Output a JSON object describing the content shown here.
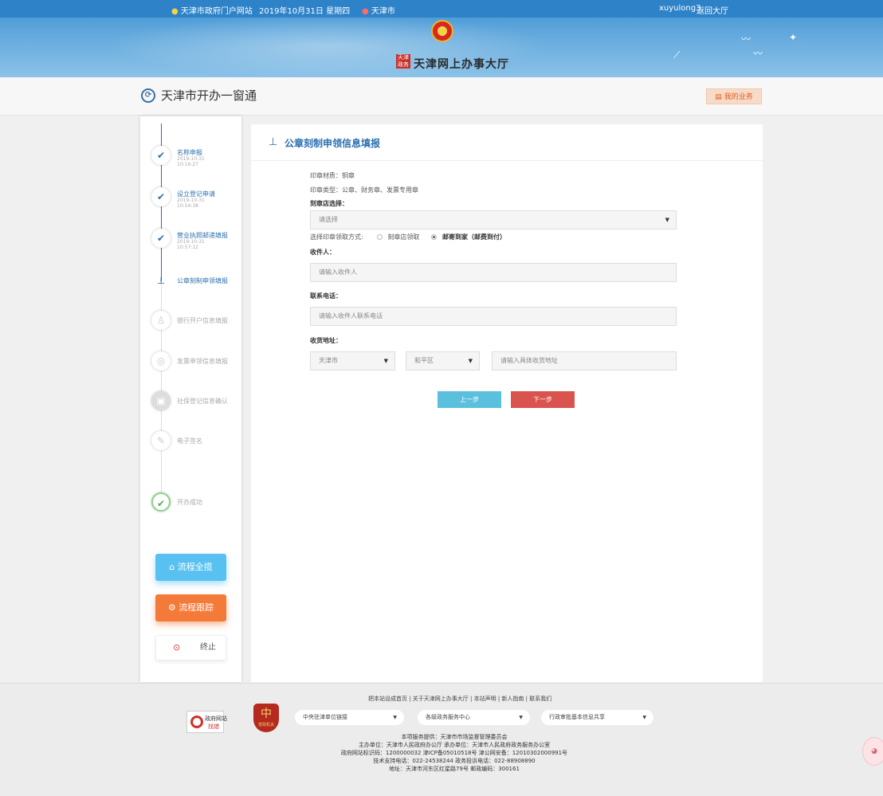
{
  "header": {
    "portal_link": "天津市政府门户网站",
    "date": "2019年10月31日 星期四",
    "city": "天津市",
    "username": "xuyulong3",
    "back_link": "返回大厅",
    "logo_badge": "天津政务",
    "hall_title": "天津网上办事大厅"
  },
  "subheader": {
    "title": "天津市开办一窗通",
    "my_business": "我的业务"
  },
  "steps": [
    {
      "label": "名称申报",
      "date": "2019-10-31\n10:16:27",
      "status": "done"
    },
    {
      "label": "设立登记申请",
      "date": "2019-10-31\n10:54:38",
      "status": "done"
    },
    {
      "label": "营业执照邮递填报",
      "date": "2019-10-31\n10:57:12",
      "status": "done"
    },
    {
      "label": "公章刻制申领填报",
      "date": "",
      "status": "current"
    },
    {
      "label": "银行开户信息填报",
      "date": "",
      "status": "todo"
    },
    {
      "label": "发票申领信息填报",
      "date": "",
      "status": "todo"
    },
    {
      "label": "社保登记信息确认",
      "date": "",
      "status": "todo"
    },
    {
      "label": "电子签名",
      "date": "",
      "status": "todo"
    },
    {
      "label": "开办成功",
      "date": "",
      "status": "success"
    }
  ],
  "side_buttons": {
    "overview": "流程全揽",
    "track": "流程跟踪",
    "stop": "终止"
  },
  "form": {
    "title": "公章刻制申领信息填报",
    "material": "印章材质：铜章",
    "seal_types": "印章类型：公章、财务章、发票专用章",
    "shop_label": "刻章店选择：",
    "shop_value": "请选择",
    "pickup_label": "选择印章领取方式:",
    "pickup_opt1": "刻章店领取",
    "pickup_opt2": "邮寄到家（邮费到付）",
    "receiver_label": "收件人：",
    "receiver_placeholder": "请输入收件人",
    "phone_label": "联系电话：",
    "phone_placeholder": "请输入收件人联系电话",
    "address_label": "收货地址：",
    "city_value": "天津市",
    "district_value": "和平区",
    "address_placeholder": "请输入具体收货地址",
    "prev_button": "上一步",
    "next_button": "下一步"
  },
  "footer": {
    "links": "把本站设成首页 | 关于天津网上办事大厅 | 本站声明 | 新人指南 | 联系我们",
    "gov_badge_top": "政府网站",
    "gov_badge_bottom": "找错",
    "party_badge": "党政机关",
    "select1": "中央驻津单位链接",
    "select2": "各级政务服务中心",
    "select3": "行政审批基本信息共享",
    "line1": "本项服务提供：天津市市场监督管理委员会",
    "line2": "主办单位：天津市人民政府办公厅 承办单位：天津市人民政府政务服务办公室",
    "line3": "政府网站标识码：1200000032 津ICP备05010518号 津公网安备：12010302000991号",
    "line4": "技术支持电话：022-24538244 政务投诉电话：022-88908890",
    "line5": "地址：天津市河东区红星路79号 邮政编码：300161"
  },
  "colors": {
    "primary": "#2b6fb0",
    "prev_button": "#5bc0de",
    "next_button": "#d9534f",
    "overview_button": "#59c1f1",
    "track_button": "#f47a3a"
  }
}
